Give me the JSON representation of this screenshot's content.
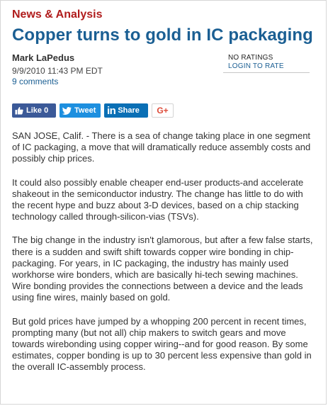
{
  "article": {
    "kicker": "News & Analysis",
    "title": "Copper turns to gold in IC packaging",
    "author": "Mark LaPedus",
    "date": "9/9/2010 11:43 PM EDT",
    "comments": "9 comments"
  },
  "rating": {
    "label": "NO RATINGS",
    "login": "LOGIN TO RATE"
  },
  "share": {
    "facebook": "Like 0",
    "twitter": "Tweet",
    "linkedin": "Share",
    "linkedin_logo": "in",
    "google": "G+"
  },
  "icons": {
    "facebook": "thumbs-up-icon",
    "twitter": "twitter-bird-icon",
    "linkedin": "linkedin-icon",
    "google": "google-plus-icon"
  },
  "colors": {
    "kicker": "#b01c1c",
    "title": "#1b5f93",
    "facebook": "#3b5998",
    "twitter": "#1d8fdf",
    "linkedin": "#0a6fb5",
    "google": "#dd4b39"
  },
  "body": {
    "p1": "SAN JOSE, Calif. - There is a sea of change taking place in one segment of IC packaging, a move that will dramatically reduce assembly costs and possibly chip prices.",
    "p2": "It could also possibly enable cheaper end-user products-and accelerate shakeout in the semiconductor industry. The change has little to do with the recent hype and buzz about 3-D devices, based on a chip stacking technology called through-silicon-vias (TSVs).",
    "p3": "The big change in the industry isn't glamorous, but after a few false starts, there is a sudden and swift shift towards copper wire bonding in chip-packaging. For years, in IC packaging, the industry has mainly used workhorse wire bonders, which are basically hi-tech sewing machines. Wire bonding  provides the connections between a device and the leads using fine wires, mainly based on gold.",
    "p4": "But gold prices have jumped by a whopping 200 percent in recent times, prompting many (but not all) chip makers to switch gears and move towards wirebonding using copper wiring--and for good reason. By some estimates, copper bonding is up to 30 percent less expensive than gold in the overall IC-assembly process."
  }
}
